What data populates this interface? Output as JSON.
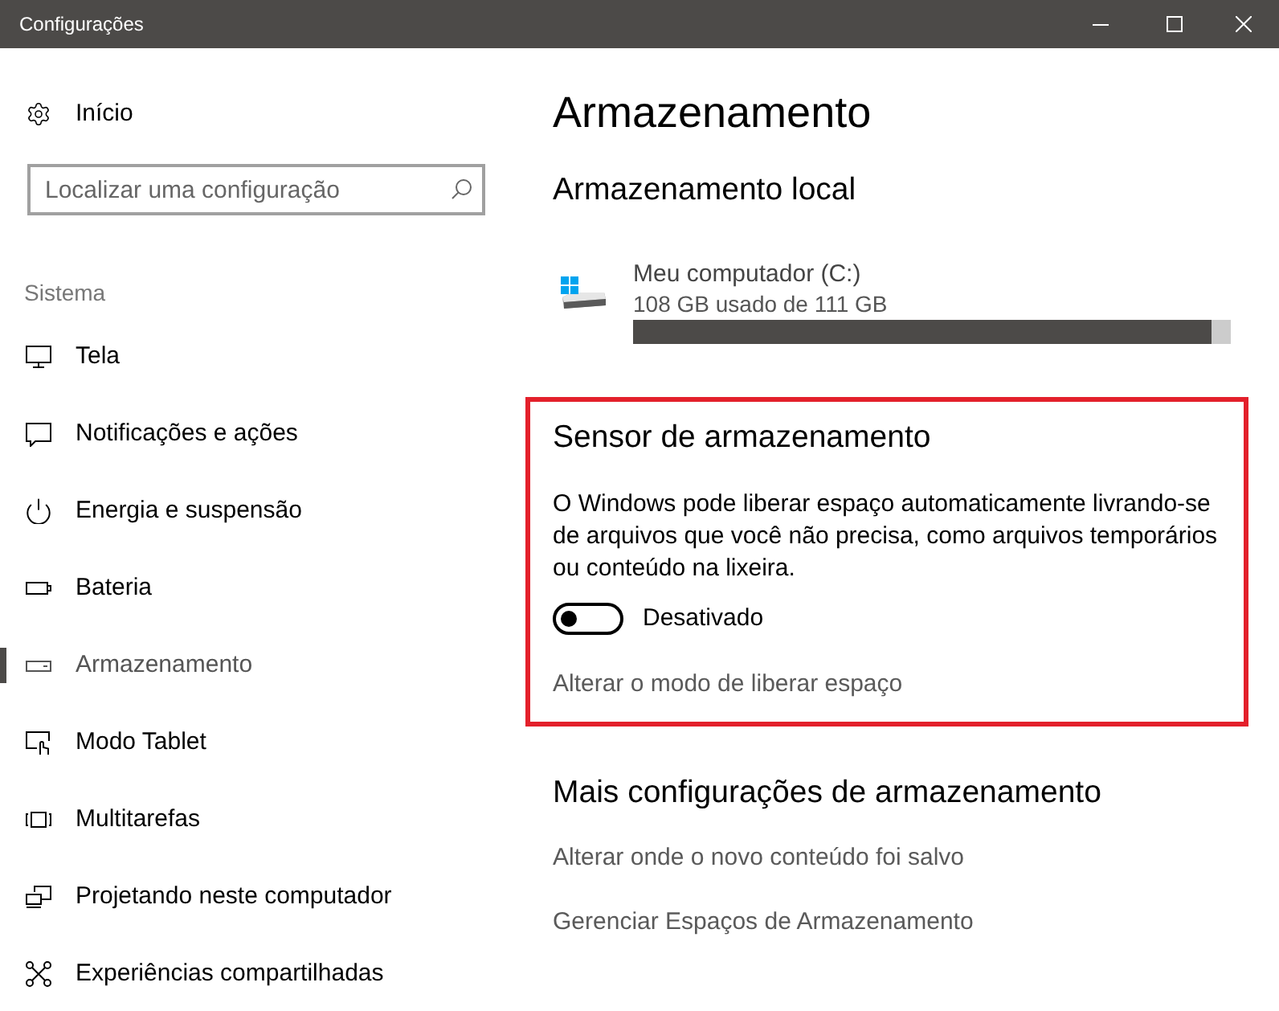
{
  "window": {
    "title": "Configurações"
  },
  "sidebar": {
    "home": {
      "label": "Início"
    },
    "search": {
      "placeholder": "Localizar uma configuração"
    },
    "section": "Sistema",
    "items": [
      {
        "label": "Tela",
        "selected": false
      },
      {
        "label": "Notificações e ações",
        "selected": false
      },
      {
        "label": "Energia e suspensão",
        "selected": false
      },
      {
        "label": "Bateria",
        "selected": false
      },
      {
        "label": "Armazenamento",
        "selected": true
      },
      {
        "label": "Modo Tablet",
        "selected": false
      },
      {
        "label": "Multitarefas",
        "selected": false
      },
      {
        "label": "Projetando neste computador",
        "selected": false
      },
      {
        "label": "Experiências compartilhadas",
        "selected": false
      }
    ]
  },
  "main": {
    "title": "Armazenamento",
    "local_storage": {
      "heading": "Armazenamento local",
      "drives": [
        {
          "name": "Meu computador (C:)",
          "usage": "108 GB usado de 111 GB",
          "level": 0.968
        }
      ]
    },
    "storage_sense": {
      "highlighted": true,
      "heading": "Sensor de armazenamento",
      "description": "O Windows pode liberar espaço automaticamente livrando-se de arquivos que você não precisa, como arquivos temporários ou conteúdo na lixeira.",
      "toggle": {
        "on": false,
        "label": "Desativado"
      },
      "link": "Alterar o modo de liberar espaço"
    },
    "more_settings": {
      "heading": "Mais configurações de armazenamento",
      "links": [
        "Alterar onde o novo conteúdo foi salvo",
        "Gerenciar Espaços de Armazenamento"
      ]
    }
  }
}
